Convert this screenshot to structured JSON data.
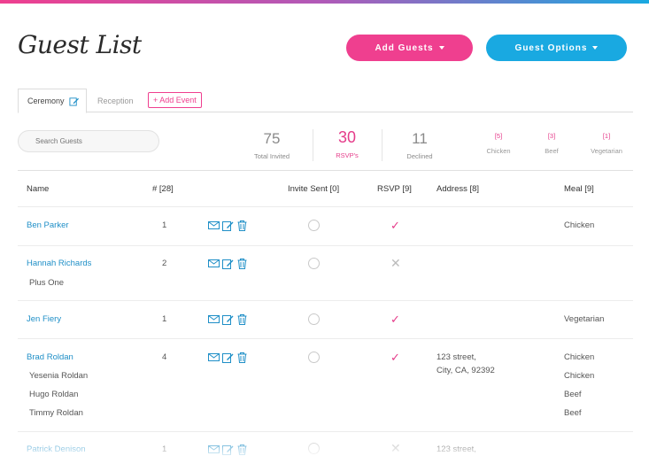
{
  "page": {
    "title": "Guest List",
    "add_guests_label": "Add Guests",
    "guest_options_label": "Guest Options"
  },
  "tabs": {
    "ceremony": "Ceremony",
    "reception": "Reception",
    "add_event": "+ Add Event"
  },
  "search": {
    "placeholder": "Search Guests"
  },
  "stats": {
    "total_invited": {
      "value": "75",
      "label": "Total Invited"
    },
    "rsvps": {
      "value": "30",
      "label": "RSVP's"
    },
    "declined": {
      "value": "11",
      "label": "Declined"
    },
    "meals": [
      {
        "count": "[5]",
        "label": "Chicken"
      },
      {
        "count": "[3]",
        "label": "Beef"
      },
      {
        "count": "[1]",
        "label": "Vegetarian"
      }
    ]
  },
  "table": {
    "headers": {
      "name": "Name",
      "count": "# [28]",
      "invite_sent": "Invite Sent [0]",
      "rsvp": "RSVP [9]",
      "address": "Address [8]",
      "meal": "Meal [9]"
    },
    "rows": [
      {
        "name": "Ben Parker",
        "count": "1",
        "rsvp": "yes",
        "address": [
          "",
          ""
        ],
        "meals": [
          "Chicken"
        ],
        "members": []
      },
      {
        "name": "Hannah Richards",
        "count": "2",
        "rsvp": "no",
        "address": [
          "",
          ""
        ],
        "meals": [],
        "members": [
          "Plus One"
        ]
      },
      {
        "name": "Jen Fiery",
        "count": "1",
        "rsvp": "yes",
        "address": [
          "",
          ""
        ],
        "meals": [
          "Vegetarian"
        ],
        "members": []
      },
      {
        "name": "Brad Roldan",
        "count": "4",
        "rsvp": "yes",
        "address": [
          "123 street,",
          "City, CA, 92392"
        ],
        "meals": [
          "Chicken",
          "Chicken",
          "Beef",
          "Beef"
        ],
        "members": [
          "Yesenia Roldan",
          "Hugo Roldan",
          "Timmy Roldan"
        ]
      },
      {
        "name": "Patrick Denison",
        "count": "1",
        "rsvp": "no",
        "address": [
          "123 street,",
          ""
        ],
        "meals": [],
        "members": []
      }
    ]
  },
  "colors": {
    "pink": "#ef3f8f",
    "blue": "#19a9e1",
    "link": "#1f8fc7"
  },
  "icons": [
    "envelope-icon",
    "edit-icon",
    "trash-icon",
    "check-icon",
    "x-icon",
    "circle-icon"
  ]
}
